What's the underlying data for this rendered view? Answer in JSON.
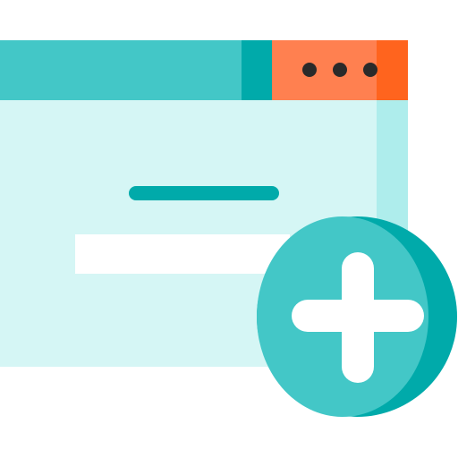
{
  "icon": {
    "name": "add-window-icon",
    "description_free": true
  },
  "colors": {
    "teal": "#43C7C7",
    "teal_dark": "#00AAAA",
    "window_body": "#D5F6F5",
    "window_body_edge": "#AEEDEC",
    "orange": "#FF8050",
    "orange_dark": "#FF641E",
    "dot": "#2A2A2A",
    "white": "#FFFFFF"
  },
  "window": {
    "control_dots": 3
  }
}
